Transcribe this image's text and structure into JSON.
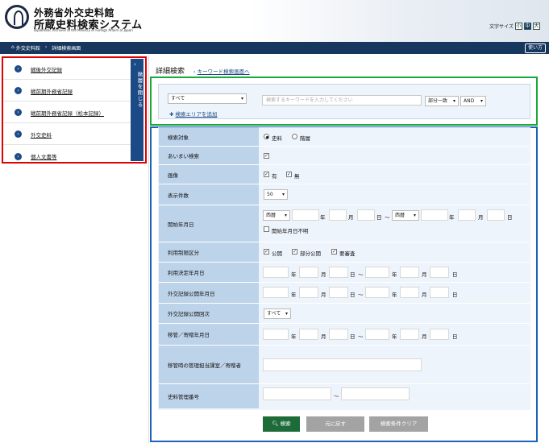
{
  "header": {
    "title_line1": "外務省外交史料館",
    "title_line2": "所蔵史料検索システム",
    "subtitle": "Diplomatic Archives of the Ministry of Foreign Affairs of Japan",
    "font_size_label": "文字サイズ",
    "font_sizes": [
      "小",
      "中",
      "大"
    ],
    "font_size_selected": "中"
  },
  "nav": {
    "home_icon": "home-icon",
    "breadcrumb": [
      "外交史料館",
      "詳細検索画面"
    ],
    "help_label": "使い方"
  },
  "sidebar": {
    "items": [
      {
        "label": "戦後外交記録"
      },
      {
        "label": "戦前期外務省記録"
      },
      {
        "label": "戦前期外務省記録（松本記録）"
      },
      {
        "label": "外交史料"
      },
      {
        "label": "個人文書等"
      }
    ],
    "toggle_label": "階層を閉じる"
  },
  "main": {
    "title": "詳細検索",
    "keyword_link": "キーワード検索画面へ",
    "keyword": {
      "scope_value": "すべて",
      "placeholder": "検索するキーワードを入力してください",
      "match_value": "部分一致",
      "logic_value": "AND",
      "add_area_label": "検索エリアを追加"
    }
  },
  "form": {
    "target": {
      "label": "検索対象",
      "options": [
        "史料",
        "階層"
      ],
      "selected": "史料"
    },
    "fuzzy": {
      "label": "あいまい検索",
      "checked": true
    },
    "image": {
      "label": "画像",
      "options": [
        "有",
        "無"
      ],
      "checked": [
        true,
        true
      ]
    },
    "display_count": {
      "label": "表示件数",
      "value": "50"
    },
    "start_date": {
      "label": "開始年月日",
      "era_from": "西暦",
      "era_to": "西暦",
      "year": "年",
      "month": "月",
      "day": "日",
      "tilde": "〜",
      "unknown_label": "開始年月日不明"
    },
    "usage_restriction": {
      "label": "利用制限区分",
      "options": [
        "公開",
        "部分公開",
        "要審査"
      ],
      "checked": [
        true,
        true,
        true
      ]
    },
    "usage_decision_date": {
      "label": "利用決定年月日"
    },
    "disclosure_date": {
      "label": "外交記録公開年月日"
    },
    "disclosure_round": {
      "label": "外交記録公開回次",
      "value": "すべて"
    },
    "transfer_date": {
      "label": "移管／寄贈年月日"
    },
    "transfer_dept": {
      "label": "移管時の管理担当課室／寄贈者"
    },
    "archive_number": {
      "label": "史料管理番号",
      "tilde": "〜"
    },
    "date_units": {
      "year": "年",
      "month": "月",
      "day": "日",
      "tilde": "〜"
    }
  },
  "buttons": {
    "search": "検索",
    "back": "元に戻す",
    "clear": "検索条件クリア"
  },
  "colors": {
    "navy": "#17375e",
    "label_bg": "#bdd3ea",
    "search_green": "#1e6b3a",
    "disabled_gray": "#9a9a9a",
    "red_box": "#e00000",
    "green_box": "#1aa83a",
    "blue_box": "#1d62b5"
  }
}
